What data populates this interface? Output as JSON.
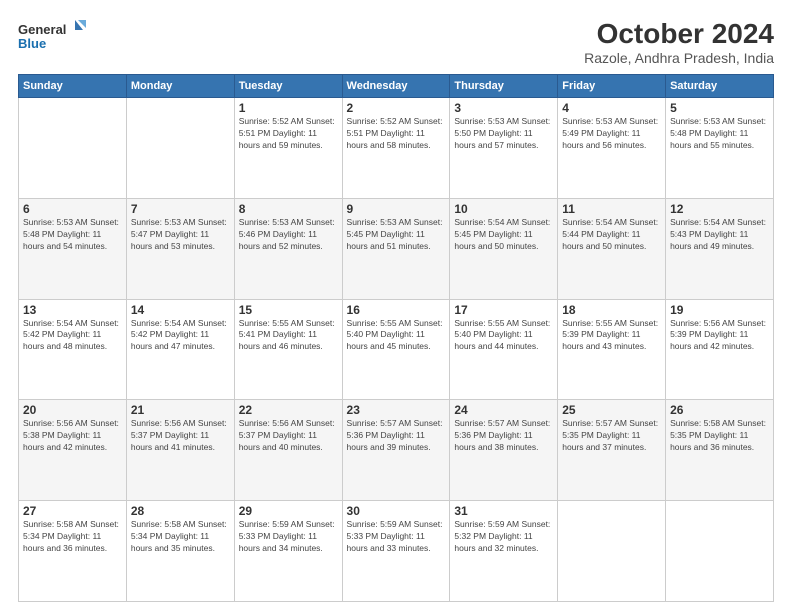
{
  "header": {
    "logo_line1": "General",
    "logo_line2": "Blue",
    "title": "October 2024",
    "subtitle": "Razole, Andhra Pradesh, India"
  },
  "days_of_week": [
    "Sunday",
    "Monday",
    "Tuesday",
    "Wednesday",
    "Thursday",
    "Friday",
    "Saturday"
  ],
  "weeks": [
    [
      {
        "day": "",
        "info": ""
      },
      {
        "day": "",
        "info": ""
      },
      {
        "day": "1",
        "info": "Sunrise: 5:52 AM\nSunset: 5:51 PM\nDaylight: 11 hours\nand 59 minutes."
      },
      {
        "day": "2",
        "info": "Sunrise: 5:52 AM\nSunset: 5:51 PM\nDaylight: 11 hours\nand 58 minutes."
      },
      {
        "day": "3",
        "info": "Sunrise: 5:53 AM\nSunset: 5:50 PM\nDaylight: 11 hours\nand 57 minutes."
      },
      {
        "day": "4",
        "info": "Sunrise: 5:53 AM\nSunset: 5:49 PM\nDaylight: 11 hours\nand 56 minutes."
      },
      {
        "day": "5",
        "info": "Sunrise: 5:53 AM\nSunset: 5:48 PM\nDaylight: 11 hours\nand 55 minutes."
      }
    ],
    [
      {
        "day": "6",
        "info": "Sunrise: 5:53 AM\nSunset: 5:48 PM\nDaylight: 11 hours\nand 54 minutes."
      },
      {
        "day": "7",
        "info": "Sunrise: 5:53 AM\nSunset: 5:47 PM\nDaylight: 11 hours\nand 53 minutes."
      },
      {
        "day": "8",
        "info": "Sunrise: 5:53 AM\nSunset: 5:46 PM\nDaylight: 11 hours\nand 52 minutes."
      },
      {
        "day": "9",
        "info": "Sunrise: 5:53 AM\nSunset: 5:45 PM\nDaylight: 11 hours\nand 51 minutes."
      },
      {
        "day": "10",
        "info": "Sunrise: 5:54 AM\nSunset: 5:45 PM\nDaylight: 11 hours\nand 50 minutes."
      },
      {
        "day": "11",
        "info": "Sunrise: 5:54 AM\nSunset: 5:44 PM\nDaylight: 11 hours\nand 50 minutes."
      },
      {
        "day": "12",
        "info": "Sunrise: 5:54 AM\nSunset: 5:43 PM\nDaylight: 11 hours\nand 49 minutes."
      }
    ],
    [
      {
        "day": "13",
        "info": "Sunrise: 5:54 AM\nSunset: 5:42 PM\nDaylight: 11 hours\nand 48 minutes."
      },
      {
        "day": "14",
        "info": "Sunrise: 5:54 AM\nSunset: 5:42 PM\nDaylight: 11 hours\nand 47 minutes."
      },
      {
        "day": "15",
        "info": "Sunrise: 5:55 AM\nSunset: 5:41 PM\nDaylight: 11 hours\nand 46 minutes."
      },
      {
        "day": "16",
        "info": "Sunrise: 5:55 AM\nSunset: 5:40 PM\nDaylight: 11 hours\nand 45 minutes."
      },
      {
        "day": "17",
        "info": "Sunrise: 5:55 AM\nSunset: 5:40 PM\nDaylight: 11 hours\nand 44 minutes."
      },
      {
        "day": "18",
        "info": "Sunrise: 5:55 AM\nSunset: 5:39 PM\nDaylight: 11 hours\nand 43 minutes."
      },
      {
        "day": "19",
        "info": "Sunrise: 5:56 AM\nSunset: 5:39 PM\nDaylight: 11 hours\nand 42 minutes."
      }
    ],
    [
      {
        "day": "20",
        "info": "Sunrise: 5:56 AM\nSunset: 5:38 PM\nDaylight: 11 hours\nand 42 minutes."
      },
      {
        "day": "21",
        "info": "Sunrise: 5:56 AM\nSunset: 5:37 PM\nDaylight: 11 hours\nand 41 minutes."
      },
      {
        "day": "22",
        "info": "Sunrise: 5:56 AM\nSunset: 5:37 PM\nDaylight: 11 hours\nand 40 minutes."
      },
      {
        "day": "23",
        "info": "Sunrise: 5:57 AM\nSunset: 5:36 PM\nDaylight: 11 hours\nand 39 minutes."
      },
      {
        "day": "24",
        "info": "Sunrise: 5:57 AM\nSunset: 5:36 PM\nDaylight: 11 hours\nand 38 minutes."
      },
      {
        "day": "25",
        "info": "Sunrise: 5:57 AM\nSunset: 5:35 PM\nDaylight: 11 hours\nand 37 minutes."
      },
      {
        "day": "26",
        "info": "Sunrise: 5:58 AM\nSunset: 5:35 PM\nDaylight: 11 hours\nand 36 minutes."
      }
    ],
    [
      {
        "day": "27",
        "info": "Sunrise: 5:58 AM\nSunset: 5:34 PM\nDaylight: 11 hours\nand 36 minutes."
      },
      {
        "day": "28",
        "info": "Sunrise: 5:58 AM\nSunset: 5:34 PM\nDaylight: 11 hours\nand 35 minutes."
      },
      {
        "day": "29",
        "info": "Sunrise: 5:59 AM\nSunset: 5:33 PM\nDaylight: 11 hours\nand 34 minutes."
      },
      {
        "day": "30",
        "info": "Sunrise: 5:59 AM\nSunset: 5:33 PM\nDaylight: 11 hours\nand 33 minutes."
      },
      {
        "day": "31",
        "info": "Sunrise: 5:59 AM\nSunset: 5:32 PM\nDaylight: 11 hours\nand 32 minutes."
      },
      {
        "day": "",
        "info": ""
      },
      {
        "day": "",
        "info": ""
      }
    ]
  ]
}
